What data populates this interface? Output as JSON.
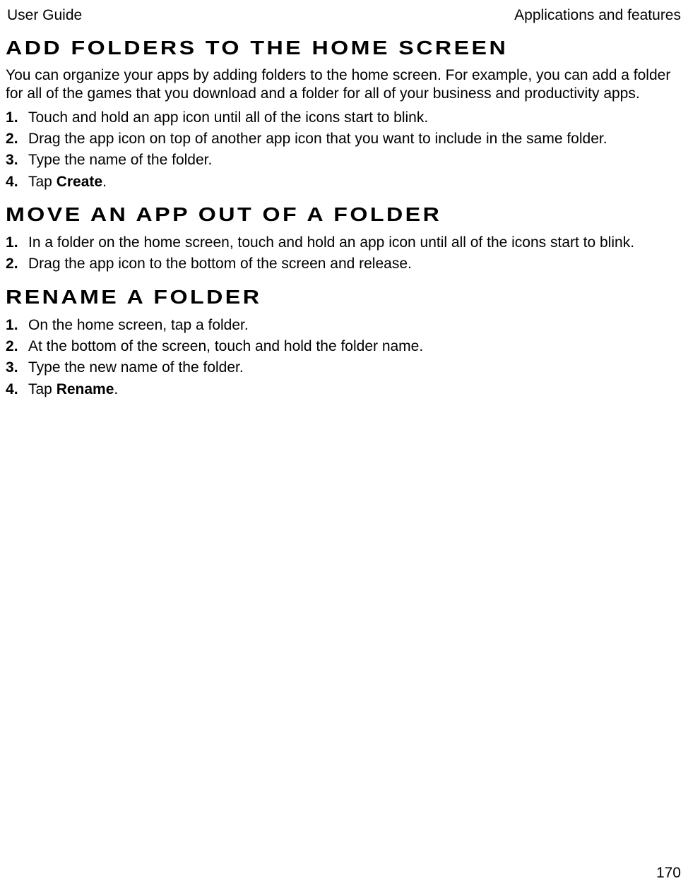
{
  "header": {
    "left": "User Guide",
    "right": "Applications and features"
  },
  "sections": [
    {
      "heading": "Add folders to the home screen",
      "intro": "You can organize your apps by adding folders to the home screen. For example, you can add a folder for all of the games that you download and a folder for all of your business and productivity apps.",
      "steps": [
        {
          "text": "Touch and hold an app icon until all of the icons start to blink."
        },
        {
          "text": "Drag the app icon on top of another app icon that you want to include in the same folder."
        },
        {
          "text": "Type the name of the folder."
        },
        {
          "prefix": "Tap ",
          "bold": "Create",
          "suffix": "."
        }
      ]
    },
    {
      "heading": "Move an app out of a folder",
      "steps": [
        {
          "text": "In a folder on the home screen, touch and hold an app icon until all of the icons start to blink."
        },
        {
          "text": "Drag the app icon to the bottom of the screen and release."
        }
      ]
    },
    {
      "heading": "Rename a folder",
      "steps": [
        {
          "text": "On the home screen, tap a folder."
        },
        {
          "text": "At the bottom of the screen, touch and hold the folder name."
        },
        {
          "text": "Type the new name of the folder."
        },
        {
          "prefix": "Tap ",
          "bold": "Rename",
          "suffix": "."
        }
      ]
    }
  ],
  "pageNumber": "170"
}
